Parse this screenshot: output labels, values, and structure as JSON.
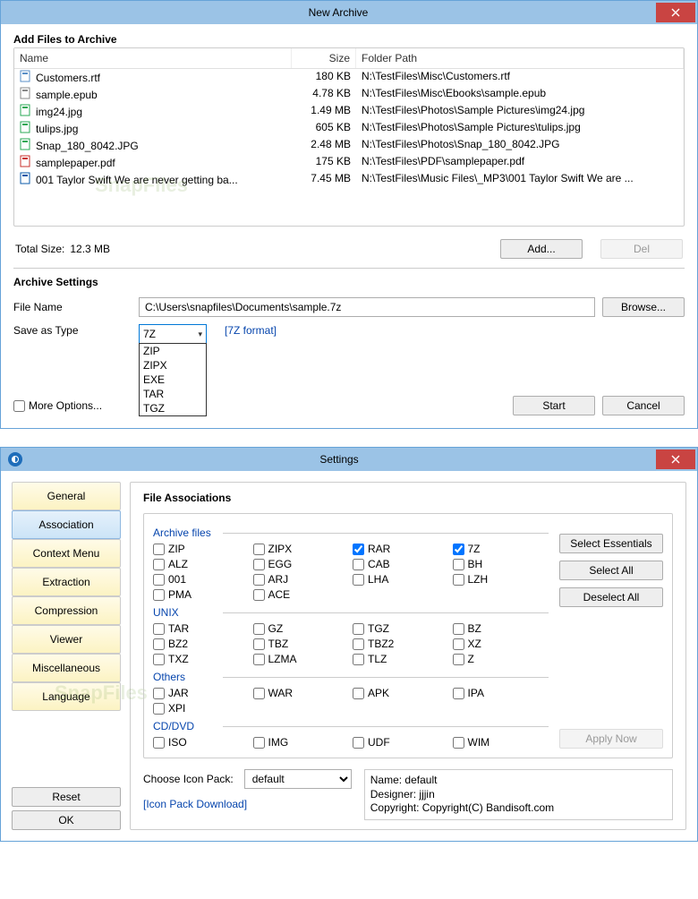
{
  "window1": {
    "title": "New Archive",
    "heading": "Add Files to Archive",
    "columns": {
      "name": "Name",
      "size": "Size",
      "path": "Folder Path"
    },
    "files": [
      {
        "icon": "rtf",
        "name": "Customers.rtf",
        "size": "180 KB",
        "path": "N:\\TestFiles\\Misc\\Customers.rtf"
      },
      {
        "icon": "epub",
        "name": "sample.epub",
        "size": "4.78 KB",
        "path": "N:\\TestFiles\\Misc\\Ebooks\\sample.epub"
      },
      {
        "icon": "jpg",
        "name": "img24.jpg",
        "size": "1.49 MB",
        "path": "N:\\TestFiles\\Photos\\Sample Pictures\\img24.jpg"
      },
      {
        "icon": "jpg",
        "name": "tulips.jpg",
        "size": "605 KB",
        "path": "N:\\TestFiles\\Photos\\Sample Pictures\\tulips.jpg"
      },
      {
        "icon": "jpg",
        "name": "Snap_180_8042.JPG",
        "size": "2.48 MB",
        "path": "N:\\TestFiles\\Photos\\Snap_180_8042.JPG"
      },
      {
        "icon": "pdf",
        "name": "samplepaper.pdf",
        "size": "175 KB",
        "path": "N:\\TestFiles\\PDF\\samplepaper.pdf"
      },
      {
        "icon": "mp3",
        "name": "001 Taylor Swift We are never getting ba...",
        "size": "7.45 MB",
        "path": "N:\\TestFiles\\Music Files\\_MP3\\001 Taylor Swift We are ..."
      }
    ],
    "total_label": "Total Size:",
    "total_size": "12.3 MB",
    "add_btn": "Add...",
    "del_btn": "Del",
    "settings_heading": "Archive Settings",
    "filename_label": "File Name",
    "filename_value": "C:\\Users\\snapfiles\\Documents\\sample.7z",
    "browse_btn": "Browse...",
    "saveastype_label": "Save as Type",
    "saveastype_value": "7Z",
    "format_link": "[7Z format]",
    "type_options": [
      "ZIP",
      "ZIPX",
      "EXE",
      "TAR",
      "TGZ"
    ],
    "more_options": "More Options...",
    "start_btn": "Start",
    "cancel_btn": "Cancel"
  },
  "window2": {
    "title": "Settings",
    "sidebar": [
      "General",
      "Association",
      "Context Menu",
      "Extraction",
      "Compression",
      "Viewer",
      "Miscellaneous",
      "Language"
    ],
    "sidebar_active": 1,
    "reset_btn": "Reset",
    "ok_btn": "OK",
    "panel_heading": "File Associations",
    "groups": [
      {
        "label": "Archive files",
        "items": [
          {
            "l": "ZIP",
            "c": false
          },
          {
            "l": "ZIPX",
            "c": false
          },
          {
            "l": "RAR",
            "c": true
          },
          {
            "l": "7Z",
            "c": true
          },
          {
            "l": "ALZ",
            "c": false
          },
          {
            "l": "EGG",
            "c": false
          },
          {
            "l": "CAB",
            "c": false
          },
          {
            "l": "BH",
            "c": false
          },
          {
            "l": "001",
            "c": false
          },
          {
            "l": "ARJ",
            "c": false
          },
          {
            "l": "LHA",
            "c": false
          },
          {
            "l": "LZH",
            "c": false
          },
          {
            "l": "PMA",
            "c": false
          },
          {
            "l": "ACE",
            "c": false
          }
        ]
      },
      {
        "label": "UNIX",
        "items": [
          {
            "l": "TAR",
            "c": false
          },
          {
            "l": "GZ",
            "c": false
          },
          {
            "l": "TGZ",
            "c": false
          },
          {
            "l": "BZ",
            "c": false
          },
          {
            "l": "BZ2",
            "c": false
          },
          {
            "l": "TBZ",
            "c": false
          },
          {
            "l": "TBZ2",
            "c": false
          },
          {
            "l": "XZ",
            "c": false
          },
          {
            "l": "TXZ",
            "c": false
          },
          {
            "l": "LZMA",
            "c": false
          },
          {
            "l": "TLZ",
            "c": false
          },
          {
            "l": "Z",
            "c": false
          }
        ]
      },
      {
        "label": "Others",
        "items": [
          {
            "l": "JAR",
            "c": false
          },
          {
            "l": "WAR",
            "c": false
          },
          {
            "l": "APK",
            "c": false
          },
          {
            "l": "IPA",
            "c": false
          },
          {
            "l": "XPI",
            "c": false
          }
        ]
      },
      {
        "label": "CD/DVD",
        "items": [
          {
            "l": "ISO",
            "c": false
          },
          {
            "l": "IMG",
            "c": false
          },
          {
            "l": "UDF",
            "c": false
          },
          {
            "l": "WIM",
            "c": false
          }
        ]
      }
    ],
    "select_essentials": "Select Essentials",
    "select_all": "Select All",
    "deselect_all": "Deselect All",
    "apply_now": "Apply Now",
    "icon_pack_label": "Choose Icon Pack:",
    "icon_pack_value": "default",
    "icon_pack_download": "[Icon Pack Download]",
    "icon_info": {
      "name": "Name: default",
      "designer": "Designer: jjjin",
      "copyright": "Copyright: Copyright(C) Bandisoft.com"
    }
  }
}
